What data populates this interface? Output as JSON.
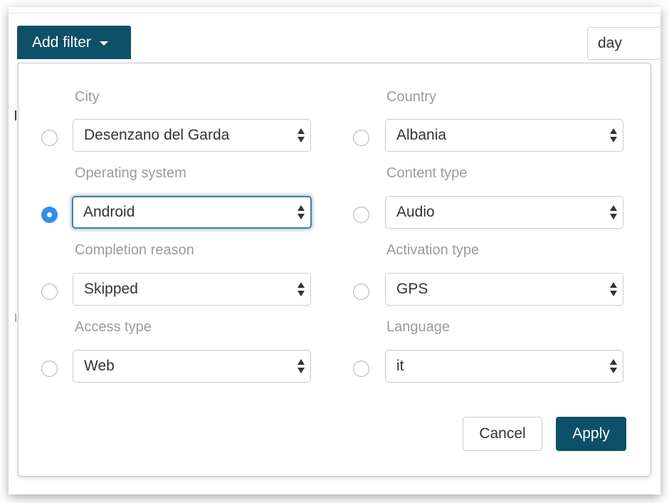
{
  "toolbar": {
    "add_filter_label": "Add filter",
    "period_value": "day"
  },
  "colors": {
    "primary": "#0e5068",
    "radio_checked": "#2f8ef0",
    "label_gray": "#9b9b9b"
  },
  "filters": [
    {
      "label": "City",
      "value": "Desenzano del Garda",
      "selected": false
    },
    {
      "label": "Country",
      "value": "Albania",
      "selected": false
    },
    {
      "label": "Operating system",
      "value": "Android",
      "selected": true
    },
    {
      "label": "Content type",
      "value": "Audio",
      "selected": false
    },
    {
      "label": "Completion reason",
      "value": "Skipped",
      "selected": false
    },
    {
      "label": "Activation type",
      "value": "GPS",
      "selected": false
    },
    {
      "label": "Access type",
      "value": "Web",
      "selected": false
    },
    {
      "label": "Language",
      "value": "it",
      "selected": false
    }
  ],
  "actions": {
    "cancel_label": "Cancel",
    "apply_label": "Apply"
  }
}
